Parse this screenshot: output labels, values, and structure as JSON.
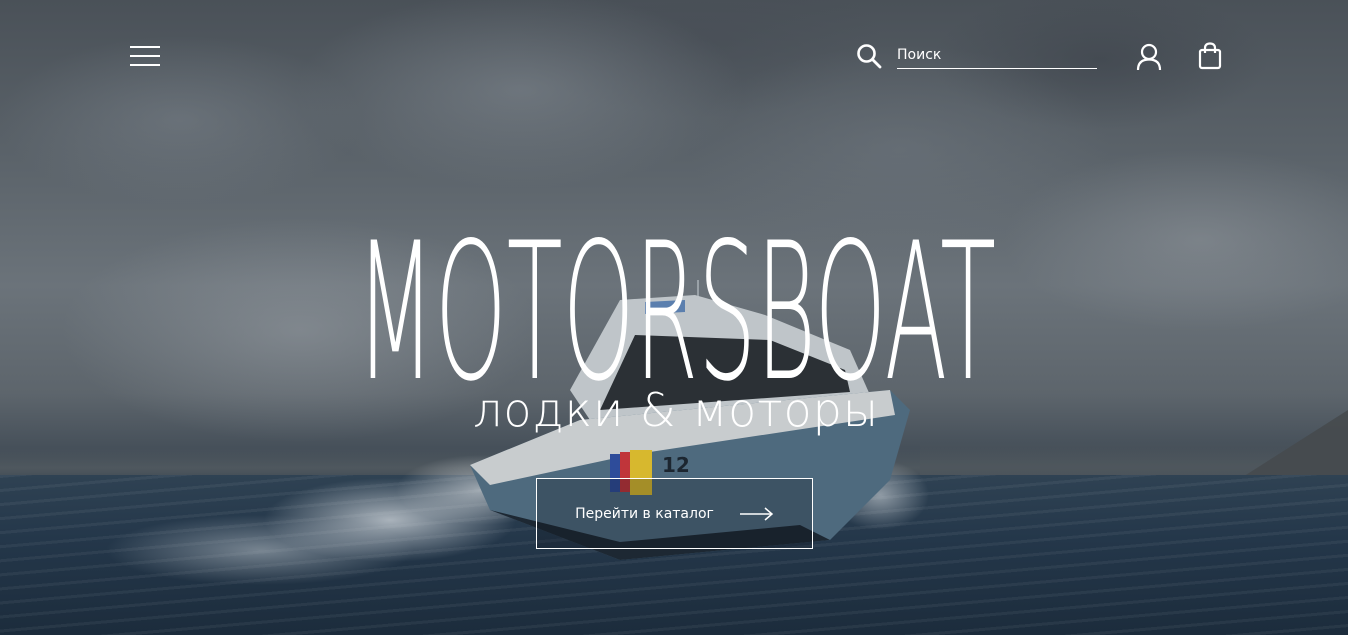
{
  "header": {
    "search_placeholder": "Поиск"
  },
  "hero": {
    "brand_title": "MOTORSBOAT",
    "subtitle": "лодки & моторы",
    "cta_label": "Перейти в каталог"
  },
  "boat": {
    "hull_number": "12"
  },
  "icons": {
    "menu": "hamburger-menu-icon",
    "search": "search-icon",
    "account": "user-icon",
    "cart": "shopping-bag-icon",
    "cta": "arrow-right-icon"
  },
  "colors": {
    "text": "#ffffff",
    "sky": "#5b636a",
    "sea": "#24374a"
  }
}
